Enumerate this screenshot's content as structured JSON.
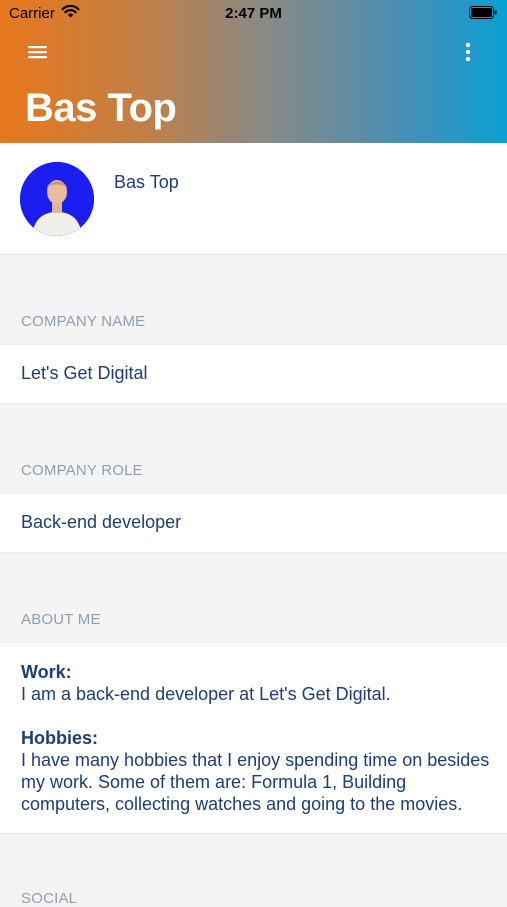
{
  "status_bar": {
    "carrier": "Carrier",
    "time": "2:47 PM"
  },
  "header": {
    "title": "Bas Top",
    "menu_icon": "hamburger-menu-icon",
    "more_icon": "more-vertical-icon",
    "gradient_colors": [
      "#e8771c",
      "#8a8a86",
      "#0b9fd6"
    ]
  },
  "profile": {
    "name": "Bas Top",
    "avatar_bg": "#1b1ef0"
  },
  "sections": {
    "company_name": {
      "label": "COMPANY NAME",
      "value": "Let's Get Digital"
    },
    "company_role": {
      "label": "COMPANY ROLE",
      "value": "Back-end developer"
    },
    "about_me": {
      "label": "ABOUT ME",
      "work_heading": "Work:",
      "work_text": "I am a back-end developer at Let's Get Digital.",
      "hobbies_heading": "Hobbies:",
      "hobbies_text": "I have many hobbies that I enjoy spending time on besides my work. Some of them are: Formula 1, Building computers, collecting watches and going to the movies."
    },
    "social": {
      "label": "SOCIAL"
    }
  },
  "colors": {
    "text_primary": "#1c3f74",
    "section_label": "#8d9fb5",
    "background": "#f4f4f4"
  }
}
